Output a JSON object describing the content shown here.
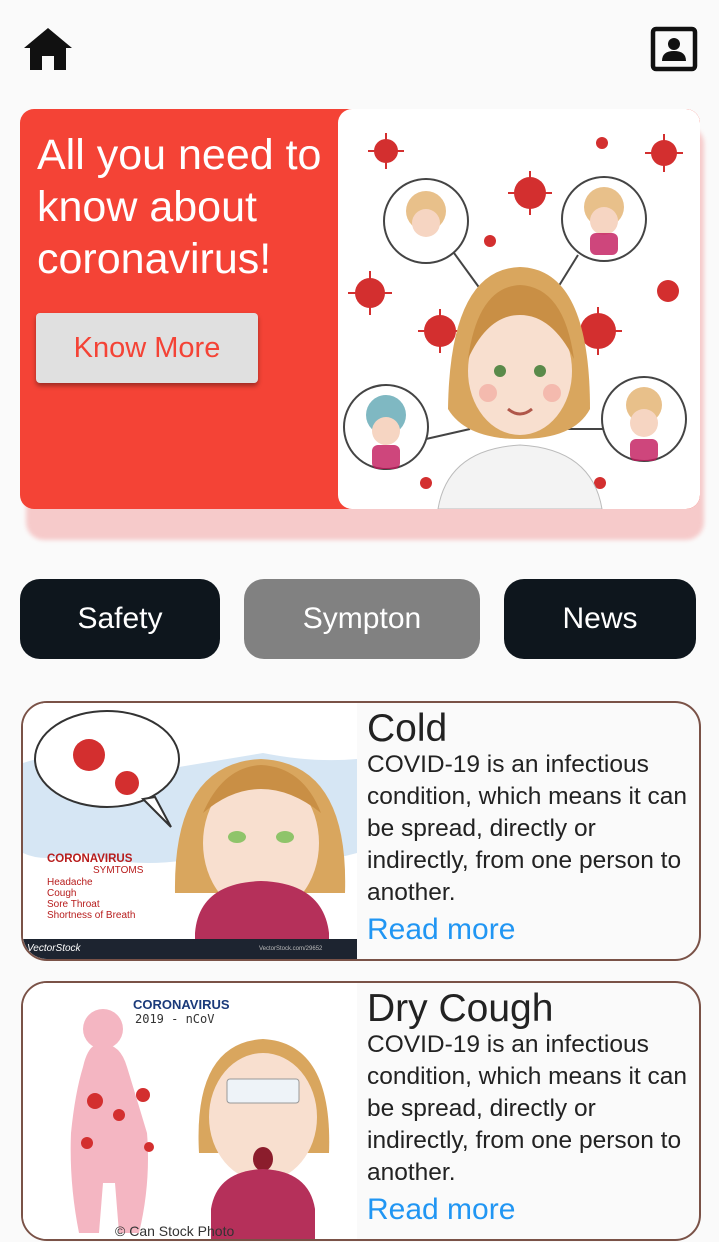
{
  "header": {
    "home_icon": "home-icon",
    "profile_icon": "contact-card-icon"
  },
  "banner": {
    "title": "All you need to know about coronavirus!",
    "button_label": "Know More",
    "colors": {
      "background": "#f44336",
      "button_bg": "#e0e0e0",
      "button_text": "#f44336"
    }
  },
  "tabs": [
    {
      "label": "Safety",
      "active": false
    },
    {
      "label": "Sympton",
      "active": true
    },
    {
      "label": "News",
      "active": false
    }
  ],
  "cards": [
    {
      "title": "Cold",
      "description": "COVID-19 is an infectious condition, which means it can be spread, directly or indirectly, from one person to another.",
      "link": "Read more",
      "image": {
        "heading": "CORONAVIRUS",
        "subheading": "SYMTOMS",
        "list": [
          "Headache",
          "Cough",
          "Sore Throat",
          "Shortness of Breath"
        ],
        "watermark": "VectorStock",
        "watermark_id": "VectorStock.com/29652"
      }
    },
    {
      "title": "Dry Cough",
      "description": "COVID-19 is an infectious condition, which means it can be spread, directly or indirectly, from one person to another.",
      "link": "Read more",
      "image": {
        "heading": "CORONAVIRUS",
        "subheading": "2019 - nCoV",
        "watermark": "© Can Stock Photo"
      }
    }
  ],
  "colors": {
    "link": "#2196f3",
    "tab_dark": "#0e161d",
    "tab_active": "#818181",
    "card_border": "#7a5247"
  }
}
